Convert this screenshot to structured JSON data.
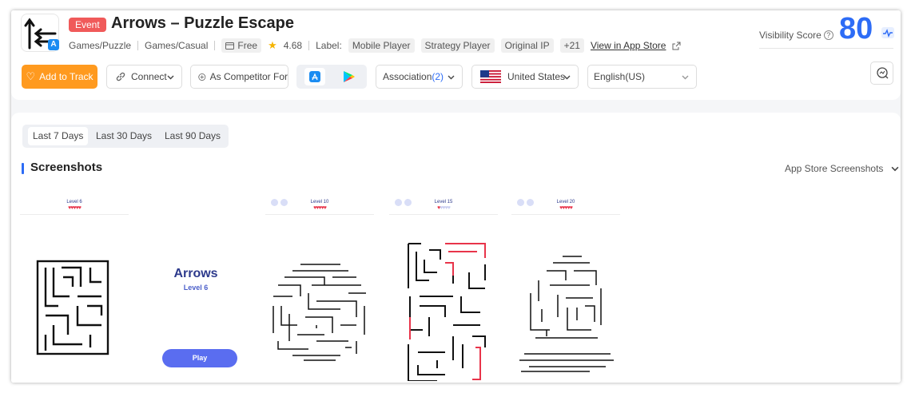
{
  "app": {
    "event_badge": "Event",
    "title": "Arrows – Puzzle Escape",
    "category_1": "Games/Puzzle",
    "category_2": "Games/Casual",
    "price": "Free",
    "rating": "4.68",
    "label_caption": "Label:",
    "labels": [
      "Mobile Player",
      "Strategy Player",
      "Original IP"
    ],
    "labels_more": "+21",
    "store_link": "View in App Store"
  },
  "visibility": {
    "label": "Visibility Score",
    "score": "80"
  },
  "toolbar": {
    "track_label": "Add to Track",
    "connect_label": "Connect",
    "competitor_label": "As Competitor For",
    "association_label": "Association",
    "association_count": "(2)",
    "country_label": "United States",
    "language_label": "English(US)"
  },
  "periods": [
    "Last 7 Days",
    "Last 30 Days",
    "Last 90 Days"
  ],
  "section": {
    "title": "Screenshots",
    "store_select": "App Store Screenshots"
  },
  "screenshots": [
    {
      "level": "Level 6",
      "hearts_full": "♥♥♥♥♥",
      "hearts_empty": ""
    },
    {
      "logo_text": "Arrows",
      "level": "Level 6",
      "play_label": "Play"
    },
    {
      "level": "Level 10",
      "hearts_full": "♥♥♥♥♥",
      "hearts_empty": ""
    },
    {
      "level": "Level 15",
      "hearts_full": "♥",
      "hearts_empty": "♥♥♥♥"
    },
    {
      "level": "Level 20",
      "hearts_full": "♥♥♥♥♥",
      "hearts_empty": ""
    }
  ],
  "colors": {
    "accent": "#2d6cf6",
    "track_button": "#ff9a1f",
    "event_badge": "#f05a5a",
    "maze_highlight": "#e8344a"
  },
  "icons": [
    "app-icon",
    "app-store-badge-icon",
    "star-icon",
    "external-link-icon",
    "help-icon",
    "pulse-icon",
    "heart-icon",
    "link-icon",
    "chevron-down-icon",
    "plus-circle-icon",
    "app-store-icon",
    "google-play-icon",
    "us-flag-icon",
    "compare-icon"
  ]
}
